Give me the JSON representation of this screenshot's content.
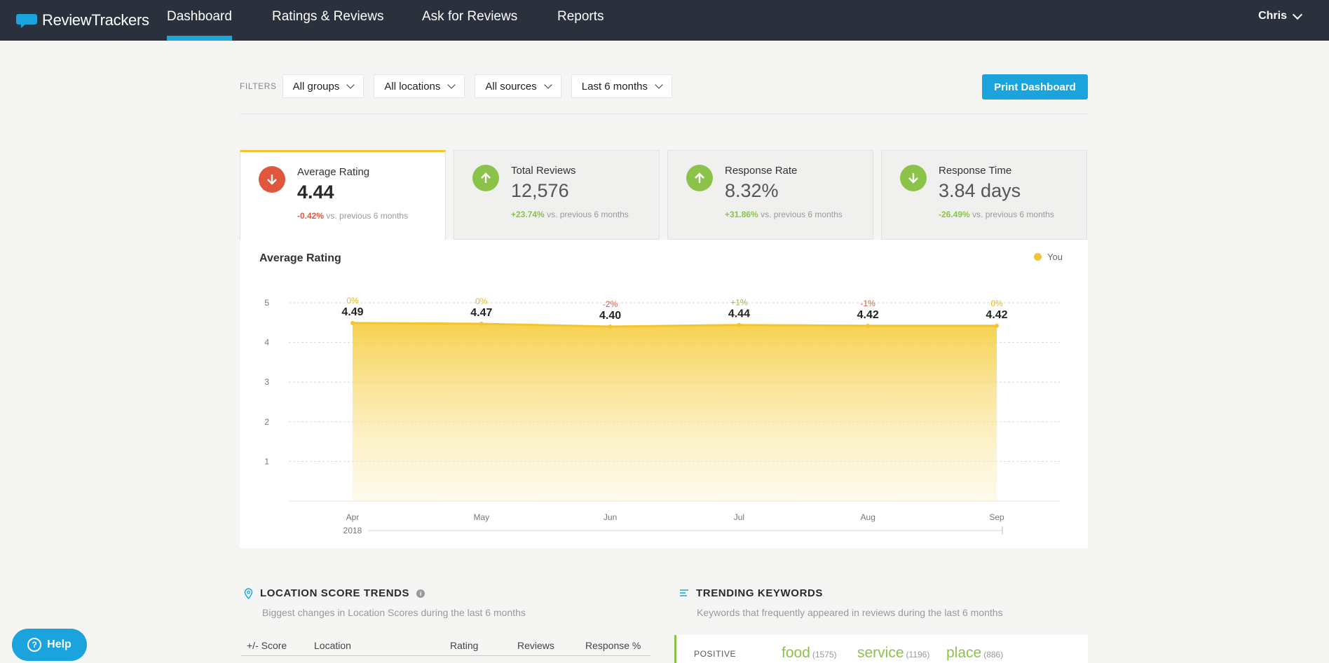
{
  "nav": {
    "logo": "ReviewTrackers",
    "items": [
      {
        "label": "Dashboard",
        "active": true
      },
      {
        "label": "Ratings & Reviews",
        "active": false
      },
      {
        "label": "Ask for Reviews",
        "active": false
      },
      {
        "label": "Reports",
        "active": false
      }
    ],
    "user": "Chris"
  },
  "filters": {
    "label": "FILTERS",
    "options": [
      "All groups",
      "All locations",
      "All sources",
      "Last 6 months"
    ],
    "print_label": "Print Dashboard"
  },
  "stats": [
    {
      "title": "Average Rating",
      "value": "4.44",
      "change": "-0.42%",
      "trend": "down",
      "suffix": "vs. previous 6 months"
    },
    {
      "title": "Total Reviews",
      "value": "12,576",
      "change": "+23.74%",
      "trend": "up",
      "suffix": "vs. previous 6 months"
    },
    {
      "title": "Response Rate",
      "value": "8.32%",
      "change": "+31.86%",
      "trend": "up",
      "suffix": "vs. previous 6 months"
    },
    {
      "title": "Response Time",
      "value": "3.84 days",
      "change": "-26.49%",
      "trend": "down-good",
      "suffix": "vs. previous 6 months"
    }
  ],
  "colors": {
    "nav_bg": "#2a313d",
    "accent": "#1aa3dc",
    "series": "#f4c430",
    "negative": "#e0573d",
    "positive": "#8bc34a"
  },
  "chart_data": {
    "type": "area",
    "title": "Average Rating",
    "categories": [
      "Apr",
      "May",
      "Jun",
      "Jul",
      "Aug",
      "Sep"
    ],
    "year_label": "2018",
    "series": [
      {
        "name": "You",
        "values": [
          4.49,
          4.47,
          4.4,
          4.44,
          4.42,
          4.42
        ],
        "changes": [
          "0%",
          "0%",
          "-2%",
          "+1%",
          "-1%",
          "0%"
        ]
      }
    ],
    "yticks": [
      1,
      2,
      3,
      4,
      5
    ],
    "ylim": [
      0,
      5
    ],
    "grid": true,
    "legend": "top-right"
  },
  "location_trends": {
    "title": "LOCATION SCORE TRENDS",
    "subtitle": "Biggest changes in Location Scores during the last 6 months",
    "columns": [
      "+/- Score",
      "Location",
      "Rating",
      "Reviews",
      "Response %"
    ]
  },
  "keywords": {
    "title": "TRENDING KEYWORDS",
    "subtitle": "Keywords that frequently appeared in reviews during the last 6 months",
    "positive_label": "POSITIVE",
    "positive": [
      {
        "word": "food",
        "count": "(1575)"
      },
      {
        "word": "service",
        "count": "(1196)"
      },
      {
        "word": "place",
        "count": "(886)"
      }
    ]
  },
  "help_label": "Help"
}
